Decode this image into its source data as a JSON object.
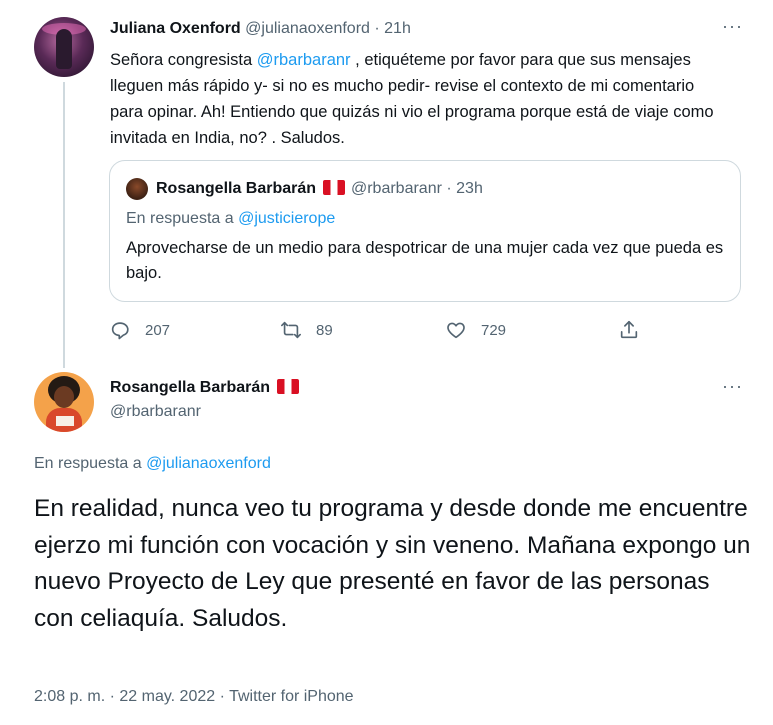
{
  "reply_tweet": {
    "author_name": "Juliana Oxenford",
    "author_handle": "@julianaoxenford",
    "time": "21h",
    "more_label": "···",
    "text_parts": {
      "before": "Señora congresista ",
      "mention": "@rbarbaranr",
      "after": " , etiquéteme por favor para que sus mensajes lleguen más rápido y- si no es mucho pedir- revise el contexto de mi comentario para opinar. Ah! Entiendo que quizás ni vio el programa porque está de viaje como invitada en India, no? . Saludos."
    },
    "quote": {
      "author_name": "Rosangella Barbarán",
      "author_handle": "@rbarbaranr",
      "time": "23h",
      "reply_prefix": "En respuesta a ",
      "reply_to": "@justicierope",
      "text": "Aprovecharse de un medio para despotricar de una mujer cada vez que pueda es bajo."
    },
    "actions": {
      "replies": "207",
      "retweets": "89",
      "likes": "729",
      "reply_icon": "reply-icon",
      "retweet_icon": "retweet-icon",
      "like_icon": "heart-icon",
      "share_icon": "share-icon"
    }
  },
  "main_tweet": {
    "author_name": "Rosangella Barbarán",
    "author_handle": "@rbarbaranr",
    "more_label": "···",
    "reply_prefix": "En respuesta a ",
    "reply_to": "@julianaoxenford",
    "text": "En realidad, nunca veo tu programa y desde donde me encuentre ejerzo mi función con vocación y sin veneno. Mañana expongo un nuevo Proyecto de Ley que presenté en favor de las personas con celiaquía. Saludos.",
    "meta": "2:08 p. m. · 22 may. 2022 · Twitter for iPhone"
  },
  "colors": {
    "link": "#1d9bf0",
    "muted": "#536471",
    "text": "#0f1419",
    "border": "#cfd9de",
    "flag_red": "#d91023"
  }
}
